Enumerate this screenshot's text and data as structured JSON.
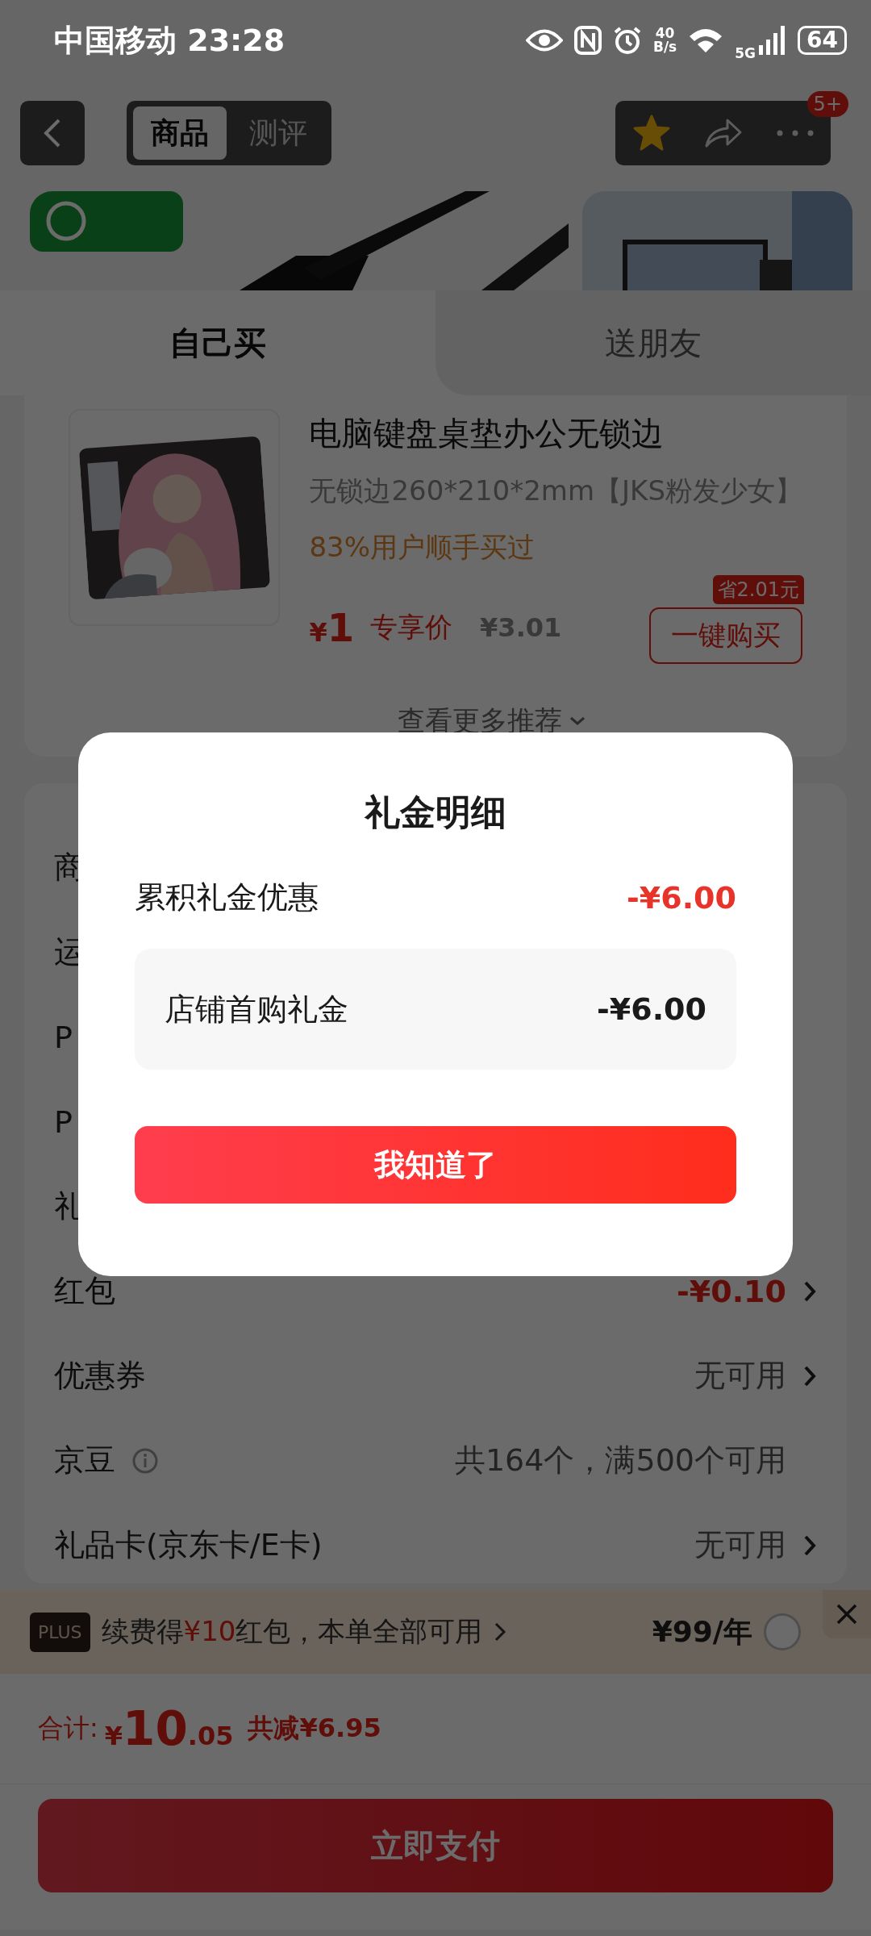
{
  "status_bar": {
    "carrier": "中国移动",
    "time": "23:28",
    "net_speed_value": "40",
    "net_speed_unit": "B/s",
    "network": "5G",
    "battery": "64"
  },
  "nav": {
    "tabs": [
      {
        "label": "商品",
        "selected": true
      },
      {
        "label": "测评",
        "selected": false
      }
    ],
    "favorite": {
      "on": true
    },
    "badge": "5+"
  },
  "buy_tabs": [
    {
      "label": "自己买",
      "selected": true
    },
    {
      "label": "送朋友",
      "selected": false
    }
  ],
  "product": {
    "title": "电脑键盘桌垫办公无锁边",
    "spec": "无锁边260*210*2mm【JKS粉发少女】",
    "social_proof": "83%用户顺手买过",
    "price_currency": "¥",
    "price_value": "1",
    "price_label": "专享价",
    "original_price": "¥3.01",
    "save_badge": "省2.01元",
    "buy_button": "一键购买",
    "more": "查看更多推荐"
  },
  "summary_rows": [
    {
      "label": "商",
      "kind": "plain"
    },
    {
      "label": "运",
      "kind": "plain"
    },
    {
      "label": "P",
      "kind": "plain"
    },
    {
      "label": "P",
      "kind": "plain"
    },
    {
      "label": "礼",
      "kind": "plain"
    },
    {
      "label": "红包",
      "value": "-¥0.10",
      "kind": "discount",
      "chevron": true
    },
    {
      "label": "优惠券",
      "value": "无可用",
      "kind": "plain",
      "chevron": true
    },
    {
      "label": "京豆",
      "value": "共164个，满500个可用",
      "kind": "plain",
      "info": true
    },
    {
      "label": "礼品卡(京东卡/E卡)",
      "value": "无可用",
      "kind": "plain",
      "chevron": true
    }
  ],
  "plus_bar": {
    "badge": "PLUS",
    "text": "续费得**¥10**红包，本单全部可用",
    "price": "¥99/年",
    "selected": false
  },
  "total": {
    "label": "合计:",
    "currency": "¥",
    "integer": "10",
    "decimal": ".05",
    "savings": "共减¥6.95"
  },
  "pay_button": "立即支付",
  "dialog": {
    "title": "礼金明细",
    "summary_label": "累积礼金优惠",
    "summary_value": "-¥6.00",
    "items": [
      {
        "label": "店铺首购礼金",
        "value": "-¥6.00"
      }
    ],
    "button": "我知道了"
  }
}
